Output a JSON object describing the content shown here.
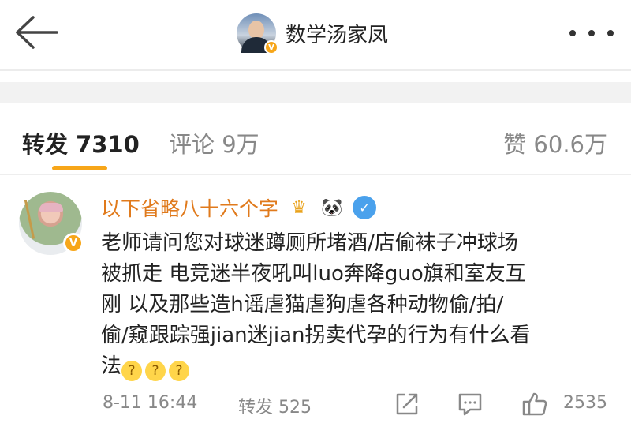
{
  "header": {
    "back_icon": "arrow-left-icon",
    "title": "数学汤家凤",
    "verified_mark": "V",
    "more_icon": "more-dots-icon"
  },
  "tabs": {
    "repost": "转发 7310",
    "comment": "评论 9万",
    "like": "赞 60.6万",
    "active": "repost",
    "accent_color": "#f7a619"
  },
  "comment": {
    "username": "以下省略八十六个字",
    "username_color": "#e07a1c",
    "avatar_verified_mark": "V",
    "badges": [
      {
        "name": "crown-badge-icon",
        "glyph": "♛"
      },
      {
        "name": "panda-badge-icon",
        "glyph": "🐼"
      },
      {
        "name": "shield-badge-icon",
        "glyph": "✓"
      }
    ],
    "lines": [
      "老师请问您对球迷蹲厕所堵酒/店偷袜子冲球场",
      "被抓走 电竞迷半夜吼叫luo奔降guo旗和室友互",
      "刚 以及那些造h谣虐猫虐狗虐各种动物偷/拍/",
      "偷/窥跟踪强jian迷jian拐卖代孕的行为有什么看",
      "法"
    ],
    "emoji_glyph": "?",
    "emoji_count": 3,
    "time": "8-11 16:44",
    "repost_label": "转发 525",
    "like_count": "2535",
    "share_icon": "share-icon",
    "comment_icon": "comment-icon",
    "like_icon": "thumbs-up-icon"
  }
}
